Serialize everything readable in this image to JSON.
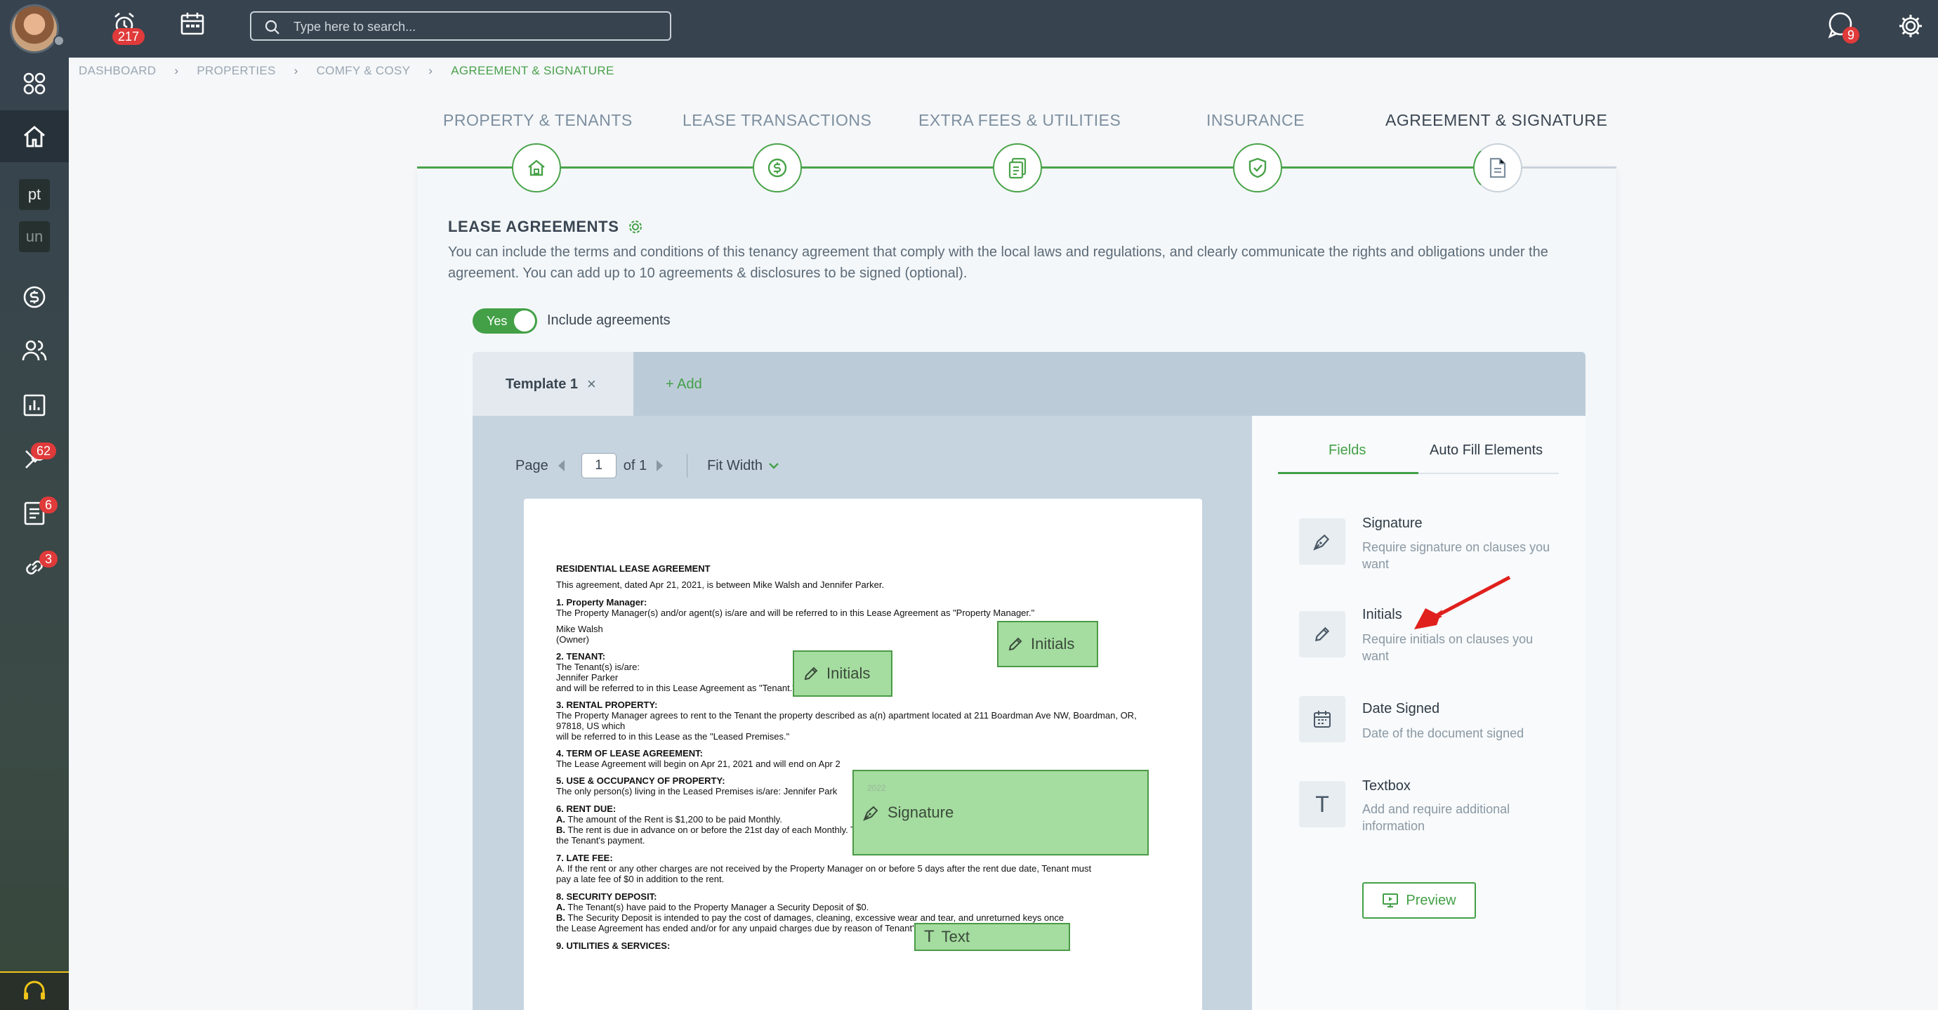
{
  "topbar": {
    "alarm_badge": "217",
    "search_placeholder": "Type here to search...",
    "chat_badge": "9"
  },
  "sidebar": {
    "items": [
      {
        "name": "apps"
      },
      {
        "name": "home"
      },
      {
        "short": "pt"
      },
      {
        "short": "un"
      },
      {
        "name": "payments"
      },
      {
        "name": "people"
      },
      {
        "name": "reports"
      },
      {
        "name": "maintenance",
        "badge": "62"
      },
      {
        "name": "documents",
        "badge": "6"
      },
      {
        "name": "links",
        "badge": "3"
      }
    ]
  },
  "breadcrumb": {
    "items": [
      "DASHBOARD",
      "PROPERTIES",
      "COMFY & COSY",
      "AGREEMENT & SIGNATURE"
    ]
  },
  "steps": [
    {
      "label": "PROPERTY & TENANTS",
      "icon": "house-icon"
    },
    {
      "label": "LEASE TRANSACTIONS",
      "icon": "dollar-icon"
    },
    {
      "label": "EXTRA FEES & UTILITIES",
      "icon": "bills-icon"
    },
    {
      "label": "INSURANCE",
      "icon": "shield-icon"
    },
    {
      "label": "AGREEMENT & SIGNATURE",
      "icon": "document-icon"
    }
  ],
  "lease": {
    "title": "LEASE AGREEMENTS",
    "description": "You can include the terms and conditions of this tenancy agreement that comply with the local laws and regulations, and clearly communicate the rights and obligations under the agreement. You can add up to 10 agreements & disclosures to be signed (optional).",
    "toggle_state": "Yes",
    "toggle_label": "Include agreements"
  },
  "templates": {
    "tab_label": "Template 1",
    "close": "×",
    "add_label": "+ Add"
  },
  "viewer": {
    "page_label": "Page",
    "page_value": "1",
    "page_total": "of 1",
    "zoom": "Fit Width"
  },
  "document": {
    "lines": [
      {
        "b": "RESIDENTIAL LEASE AGREEMENT",
        "t": ""
      },
      {
        "b": "",
        "t": "This agreement, dated Apr 21, 2021, is between Mike Walsh and Jennifer Parker."
      },
      {
        "b": "1. Property Manager:",
        "t": ""
      },
      {
        "b": "",
        "t": "The Property Manager(s) and/or agent(s) is/are and will be referred to in this Lease Agreement as \"Property Manager.\""
      },
      {
        "b": "",
        "t": "Mike Walsh"
      },
      {
        "b": "",
        "t": "(Owner)"
      },
      {
        "b": "2. TENANT:",
        "t": ""
      },
      {
        "b": "",
        "t": "The Tenant(s) is/are:"
      },
      {
        "b": "",
        "t": "Jennifer Parker"
      },
      {
        "b": "",
        "t": "and will be referred to in this Lease Agreement as \"Tenant.\""
      },
      {
        "b": "3. RENTAL PROPERTY:",
        "t": ""
      },
      {
        "b": "",
        "t": "The Property Manager agrees to rent to the Tenant the property described as a(n) apartment located at  211 Boardman Ave NW, Boardman, OR,"
      },
      {
        "b": "",
        "t": "97818, US which"
      },
      {
        "b": "",
        "t": "will be referred to in this Lease as the \"Leased Premises.\""
      },
      {
        "b": "4. TERM OF LEASE AGREEMENT:",
        "t": ""
      },
      {
        "b": "",
        "t": "The Lease Agreement will begin on Apr 21, 2021 and will end on Apr 2"
      },
      {
        "b": "5. USE & OCCUPANCY OF PROPERTY:",
        "t": ""
      },
      {
        "b": "",
        "t": "The only person(s) living in the Leased Premises is/are: Jennifer Park"
      },
      {
        "b": "6. RENT DUE:",
        "t": ""
      },
      {
        "b": "A.",
        "t": " The amount of the Rent is $1,200 to be paid Monthly."
      },
      {
        "b": "B.",
        "t": " The rent is due in advance on or before the 21st day of each Monthly. The rent due date is the date the Property Manager must receive"
      },
      {
        "b": "",
        "t": "the Tenant's payment."
      },
      {
        "b": "7. LATE FEE:",
        "t": ""
      },
      {
        "b": "",
        "t": "A. If the rent or any other charges are not received by the Property Manager on or before 5 days after the rent due date, Tenant must"
      },
      {
        "b": "",
        "t": "pay a late fee of $0 in addition to the rent."
      },
      {
        "b": "8. SECURITY DEPOSIT:",
        "t": ""
      },
      {
        "b": "A.",
        "t": " The Tenant(s) have paid to the Property Manager a Security Deposit of $0."
      },
      {
        "b": "B.",
        "t": " The Security Deposit is intended to pay the cost of damages, cleaning, excessive wear and tear, and unreturned keys once"
      },
      {
        "b": "",
        "t": "the Lease Agreement has ended and/or for any unpaid charges due by reason of Tenant's default of this Lease Agreement."
      },
      {
        "b": "9. UTILITIES & SERVICES:",
        "t": ""
      }
    ],
    "placed_fields": {
      "initials_1": "Initials",
      "initials_2": "Initials",
      "signature": "Signature",
      "text": "Text",
      "faint_year": "2022"
    }
  },
  "panel": {
    "tabs": [
      "Fields",
      "Auto Fill Elements"
    ],
    "fields": [
      {
        "title": "Signature",
        "desc": "Require signature on clauses you want",
        "icon": "pen-nib-icon"
      },
      {
        "title": "Initials",
        "desc": "Require initials on clauses you want",
        "icon": "pencil-icon"
      },
      {
        "title": "Date Signed",
        "desc": "Date of the document signed",
        "icon": "calendar-icon"
      },
      {
        "title": "Textbox",
        "desc": "Add and require additional information",
        "icon": "text-icon"
      }
    ],
    "preview_label": "Preview"
  },
  "colors": {
    "accent": "#43a047",
    "topbar": "#37434f",
    "badge": "#e03a3a",
    "annotation_arrow": "#e0201c"
  }
}
